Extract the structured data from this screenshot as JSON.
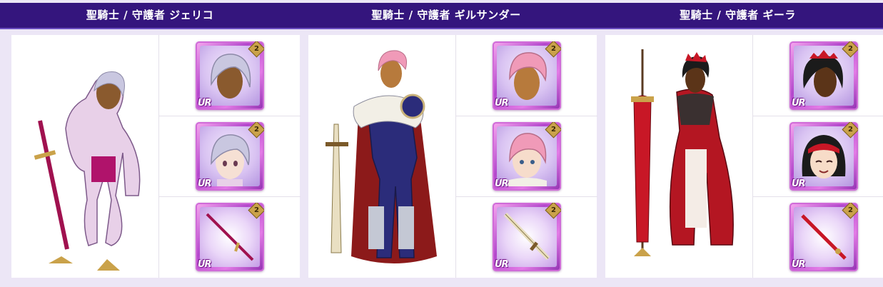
{
  "columns": [
    {
      "title": "聖騎士 / 守護者 ジェリコ",
      "theme": {
        "hair": "#c9c7e0",
        "skin": "#8a5a2e",
        "outfit": "#e8d0e8",
        "accent": "#b0136b",
        "weapon": "#a0114f"
      }
    },
    {
      "title": "聖騎士 / 守護者 ギルサンダー",
      "theme": {
        "hair": "#f09ab8",
        "skin": "#b77a3c",
        "outfit": "#2b2c7a",
        "accent": "#f2efe6",
        "weapon": "#c9b27a"
      }
    },
    {
      "title": "聖騎士 / 守護者 ギーラ",
      "theme": {
        "hair": "#1b1b1b",
        "skin": "#5b3418",
        "outfit": "#b41622",
        "accent": "#3a3030",
        "weapon": "#c81726"
      }
    }
  ],
  "badges": {
    "rank": "2",
    "rarity": "UR"
  },
  "colors": {
    "header": "#34157d",
    "frame": "#e1d6f2",
    "page_bg": "#ece6f6"
  }
}
